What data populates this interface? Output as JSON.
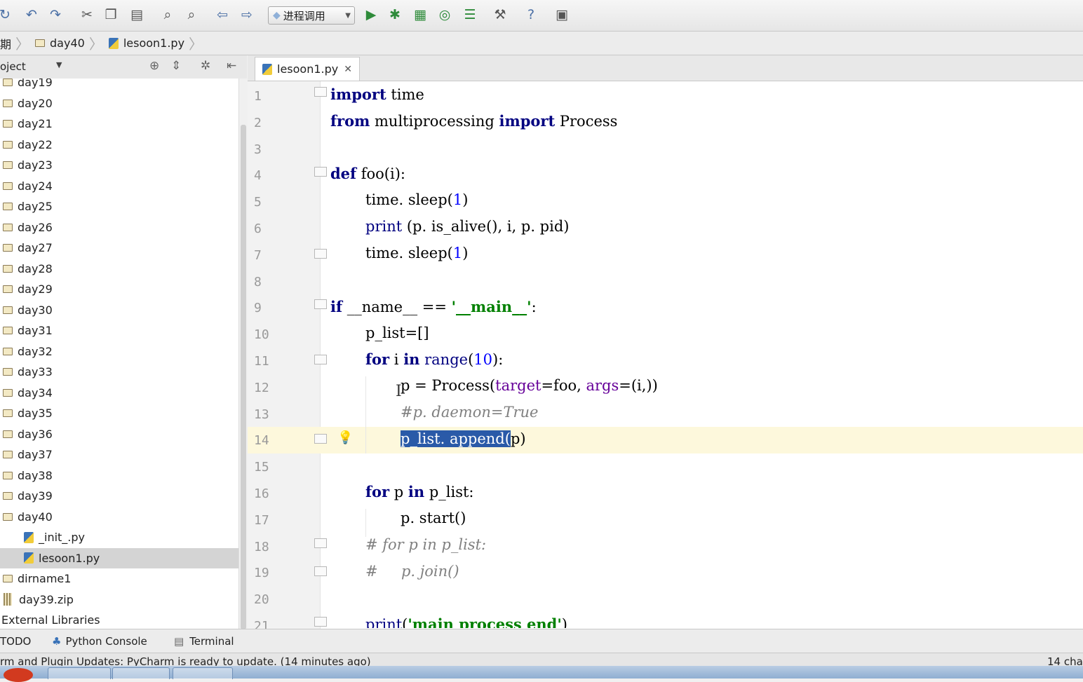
{
  "toolbar": {
    "run_config": "进程调用",
    "icons": [
      "sync-icon",
      "undo-icon",
      "redo-icon",
      "cut-icon",
      "copy-icon",
      "paste-icon",
      "find-icon",
      "replace-icon",
      "back-icon",
      "forward-icon",
      "run-icon",
      "debug-icon",
      "coverage-icon",
      "profile-icon",
      "run-file-icon",
      "settings-icon",
      "help-icon",
      "vcs-icon"
    ]
  },
  "breadcrumb": {
    "root": "期",
    "folder": "day40",
    "file": "lesoon1.py"
  },
  "project_panel": {
    "title": "oject",
    "tree": [
      {
        "label": "day19",
        "type": "folder"
      },
      {
        "label": "day20",
        "type": "folder"
      },
      {
        "label": "day21",
        "type": "folder"
      },
      {
        "label": "day22",
        "type": "folder"
      },
      {
        "label": "day23",
        "type": "folder"
      },
      {
        "label": "day24",
        "type": "folder"
      },
      {
        "label": "day25",
        "type": "folder"
      },
      {
        "label": "day26",
        "type": "folder"
      },
      {
        "label": "day27",
        "type": "folder"
      },
      {
        "label": "day28",
        "type": "folder"
      },
      {
        "label": "day29",
        "type": "folder"
      },
      {
        "label": "day30",
        "type": "folder"
      },
      {
        "label": "day31",
        "type": "folder"
      },
      {
        "label": "day32",
        "type": "folder"
      },
      {
        "label": "day33",
        "type": "folder"
      },
      {
        "label": "day34",
        "type": "folder"
      },
      {
        "label": "day35",
        "type": "folder"
      },
      {
        "label": "day36",
        "type": "folder"
      },
      {
        "label": "day37",
        "type": "folder"
      },
      {
        "label": "day38",
        "type": "folder"
      },
      {
        "label": "day39",
        "type": "folder"
      },
      {
        "label": "day40",
        "type": "folder"
      },
      {
        "label": "_init_.py",
        "type": "py"
      },
      {
        "label": "lesoon1.py",
        "type": "py",
        "selected": true
      },
      {
        "label": "dirname1",
        "type": "folder"
      },
      {
        "label": "day39.zip",
        "type": "zip"
      },
      {
        "label": "External Libraries",
        "type": "text"
      }
    ]
  },
  "editor": {
    "tab": "lesoon1.py",
    "current_line": 14,
    "lines": [
      "1",
      "2",
      "3",
      "4",
      "5",
      "6",
      "7",
      "8",
      "9",
      "10",
      "11",
      "12",
      "13",
      "14",
      "15",
      "16",
      "17",
      "18",
      "19",
      "20",
      "21"
    ],
    "code": {
      "l1_kw": "import",
      "l1_rest": " time",
      "l2_kw1": "from",
      "l2_mid": " multiprocessing ",
      "l2_kw2": "import",
      "l2_rest": " Process",
      "l4_kw": "def",
      "l4_rest": " foo(i):",
      "l5": "time. sleep(",
      "l5_num": "1",
      "l5_end": ")",
      "l6_bi": "print",
      "l6_rest": " (p. is_alive(), i, p. pid)",
      "l7": "time. sleep(",
      "l7_num": "1",
      "l7_end": ")",
      "l9_kw": "if",
      "l9_mid": " __name__ == ",
      "l9_str": "'__main__'",
      "l9_end": ":",
      "l10": "p_list=[]",
      "l11_kw1": "for",
      "l11_mid": " i ",
      "l11_kw2": "in",
      "l11_bi": " range",
      "l11_p": "(",
      "l11_num": "10",
      "l11_end": "):",
      "l12_a": "p = Process(",
      "l12_p1": "target",
      "l12_b": "=foo, ",
      "l12_p2": "args",
      "l12_c": "=(i,))",
      "l13": "#p. daemon=True",
      "l14_sel": "p_list. append(",
      "l14_rest": "p)",
      "l16_kw1": "for",
      "l16_mid": " p ",
      "l16_kw2": "in",
      "l16_rest": " p_list:",
      "l17": "p. start()",
      "l18": "# for p in p_list:",
      "l19": "#     p. join()",
      "l21_bi": "print",
      "l21_p": "(",
      "l21_str": "'main process end'",
      "l21_end": ")"
    }
  },
  "bottom_tools": {
    "todo": "TODO",
    "console": "Python Console",
    "terminal": "Terminal"
  },
  "status": {
    "message": "rm and Plugin Updates: PyCharm is ready to update. (14 minutes ago)",
    "right": "14 cha"
  }
}
